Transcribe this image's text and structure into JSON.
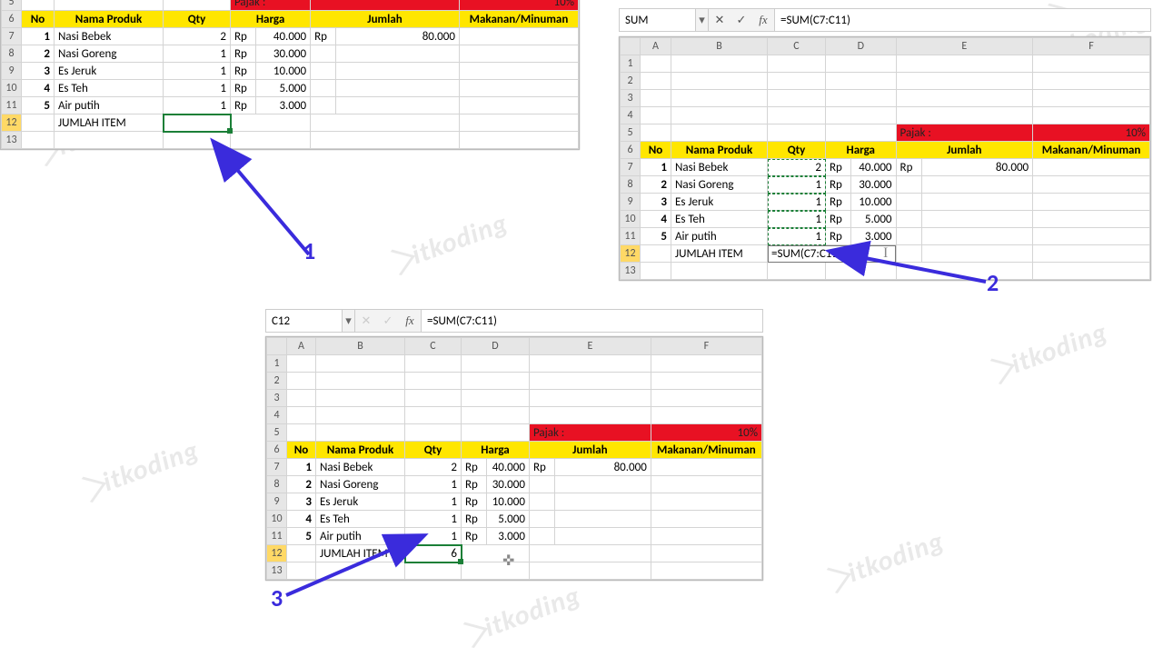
{
  "pajak": {
    "label": "Pajak :",
    "value": "10%"
  },
  "headers": {
    "no": "No",
    "nama": "Nama Produk",
    "qty": "Qty",
    "harga": "Harga",
    "jumlah": "Jumlah",
    "mm": "Makanan/Minuman"
  },
  "rows": [
    {
      "no": "1",
      "nama": "Nasi Bebek",
      "qty": "2",
      "cur": "Rp",
      "amt": "40.000",
      "jcur": "Rp",
      "jml": "80.000"
    },
    {
      "no": "2",
      "nama": "Nasi Goreng",
      "qty": "1",
      "cur": "Rp",
      "amt": "30.000",
      "jcur": "",
      "jml": ""
    },
    {
      "no": "3",
      "nama": "Es Jeruk",
      "qty": "1",
      "cur": "Rp",
      "amt": "10.000",
      "jcur": "",
      "jml": ""
    },
    {
      "no": "4",
      "nama": "Es Teh",
      "qty": "1",
      "cur": "Rp",
      "amt": "5.000",
      "jcur": "",
      "jml": ""
    },
    {
      "no": "5",
      "nama": "Air putih",
      "qty": "1",
      "cur": "Rp",
      "amt": "3.000",
      "jcur": "",
      "jml": ""
    }
  ],
  "jumlah_item_label": "JUMLAH ITEM",
  "panel2": {
    "namebox": "SUM",
    "formula": "=SUM(C7:C11)",
    "cell_formula": "=SUM(C7:C11)"
  },
  "panel3": {
    "namebox": "C12",
    "formula": "=SUM(C7:C11)",
    "result": "6"
  },
  "row_labels": [
    "1",
    "2",
    "3",
    "4",
    "5",
    "6",
    "7",
    "8",
    "9",
    "10",
    "11",
    "12",
    "13"
  ],
  "col_labels": [
    "A",
    "B",
    "C",
    "D",
    "E",
    "F"
  ],
  "annotations": {
    "a1": "1",
    "a2": "2",
    "a3": "3"
  },
  "watermark": "itkoding"
}
